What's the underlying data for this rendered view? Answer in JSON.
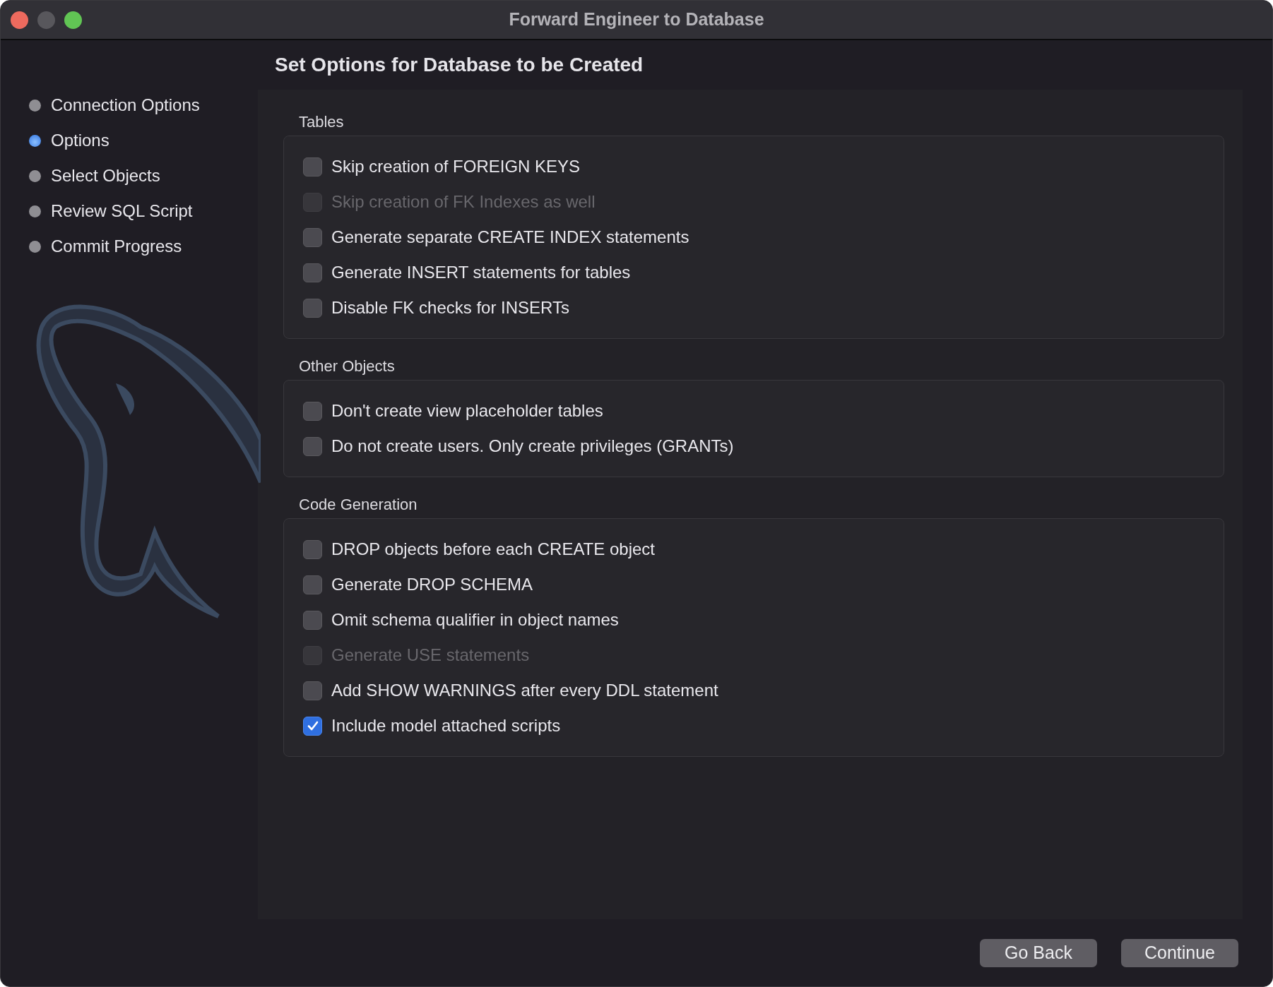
{
  "window": {
    "title": "Forward Engineer to Database"
  },
  "sidebar": {
    "items": [
      {
        "label": "Connection Options",
        "selected": false
      },
      {
        "label": "Options",
        "selected": true
      },
      {
        "label": "Select Objects",
        "selected": false
      },
      {
        "label": "Review SQL Script",
        "selected": false
      },
      {
        "label": "Commit Progress",
        "selected": false
      }
    ]
  },
  "heading": "Set Options for Database to be Created",
  "groups": [
    {
      "title": "Tables",
      "options": [
        {
          "label": "Skip creation of FOREIGN KEYS",
          "checked": false,
          "disabled": false
        },
        {
          "label": "Skip creation of FK Indexes as well",
          "checked": false,
          "disabled": true
        },
        {
          "label": "Generate separate CREATE INDEX statements",
          "checked": false,
          "disabled": false
        },
        {
          "label": "Generate INSERT statements for tables",
          "checked": false,
          "disabled": false
        },
        {
          "label": "Disable FK checks for INSERTs",
          "checked": false,
          "disabled": false
        }
      ]
    },
    {
      "title": "Other Objects",
      "options": [
        {
          "label": "Don't create view placeholder tables",
          "checked": false,
          "disabled": false
        },
        {
          "label": "Do not create users. Only create privileges (GRANTs)",
          "checked": false,
          "disabled": false
        }
      ]
    },
    {
      "title": "Code Generation",
      "options": [
        {
          "label": "DROP objects before each CREATE object",
          "checked": false,
          "disabled": false
        },
        {
          "label": "Generate DROP SCHEMA",
          "checked": false,
          "disabled": false
        },
        {
          "label": "Omit schema qualifier in object names",
          "checked": false,
          "disabled": false
        },
        {
          "label": "Generate USE statements",
          "checked": false,
          "disabled": true
        },
        {
          "label": "Add SHOW WARNINGS after every DDL statement",
          "checked": false,
          "disabled": false
        },
        {
          "label": "Include model attached scripts",
          "checked": true,
          "disabled": false
        }
      ]
    }
  ],
  "buttons": [
    "Go Back",
    "Continue"
  ]
}
